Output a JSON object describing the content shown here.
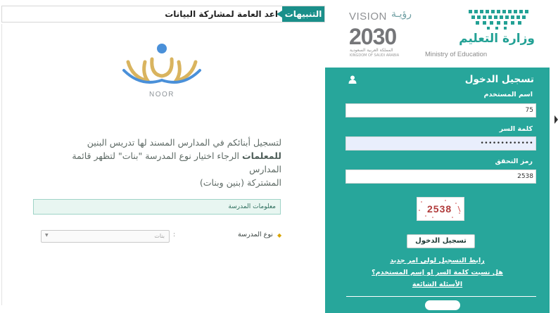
{
  "alerts": {
    "label": "التنبيهات",
    "text": "اعد العامة لمشاركة البيانات"
  },
  "left": {
    "intro_line1": "لتسجيل أبنائكم في المدارس المسند لها تدريس البنين",
    "intro_bold": "للمعلمات",
    "intro_line2_rest": "الرجاء اختيار نوع المدرسة \"بنات\" لتظهر قائمة المدارس",
    "intro_line3": "المشتركة (بنين وبنات)",
    "section_title": "معلومات المدرسة",
    "school_type_label": "نوع المدرسة",
    "school_type_value": "بنات",
    "colon": ":"
  },
  "logos": {
    "noor": "NOOR",
    "vision_en": "VISION",
    "vision_ar": "رؤيـة",
    "vision_year": "2030",
    "vision_sub_ar": "المملكة العربية السعودية",
    "vision_sub_en": "KINGDOM OF SAUDI ARABIA",
    "ministry_ar": "وزارة التعليم",
    "ministry_en": "Ministry of Education"
  },
  "login": {
    "title": "تسجيل الدخول",
    "username_label": "اسم المستخدم",
    "username_value": "75",
    "password_label": "كلمة السر",
    "password_value": "•••••••••••••",
    "captcha_label": "رمز التحقق",
    "captcha_value": "2538",
    "captcha_image_text": "2538",
    "submit_label": "تسجيل الدخول",
    "link_parent": "رابط التسجيل لولي امر جديد",
    "link_forgot": "هل نسيت كلمة السر او إسم المستخدم؟",
    "link_faq": "الأسئلة الشائعة"
  },
  "colors": {
    "teal": "#27a69b",
    "alert_teal": "#1a8f8a"
  }
}
